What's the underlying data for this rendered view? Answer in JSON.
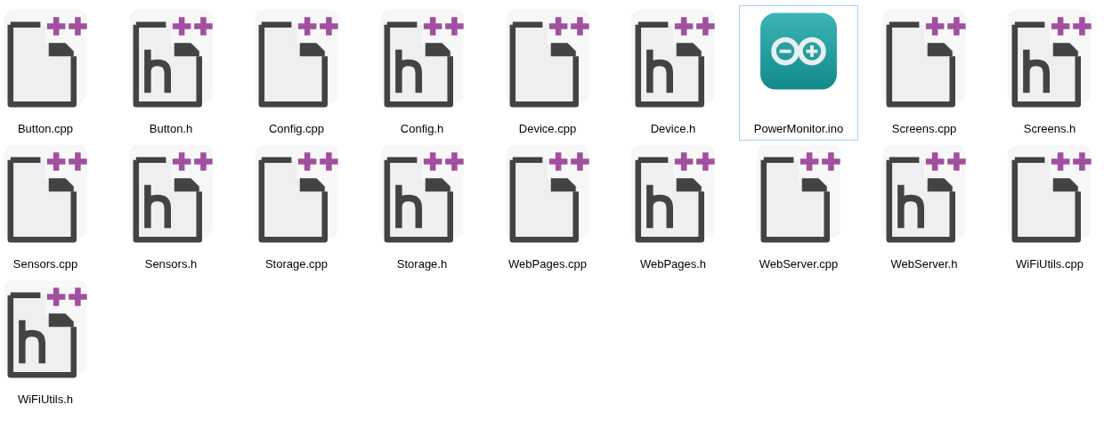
{
  "files": [
    {
      "name": "Button.cpp",
      "kind": "cpp",
      "selected": false
    },
    {
      "name": "Button.h",
      "kind": "h",
      "selected": false
    },
    {
      "name": "Config.cpp",
      "kind": "cpp",
      "selected": false
    },
    {
      "name": "Config.h",
      "kind": "h",
      "selected": false
    },
    {
      "name": "Device.cpp",
      "kind": "cpp",
      "selected": false
    },
    {
      "name": "Device.h",
      "kind": "h",
      "selected": false
    },
    {
      "name": "PowerMonitor.ino",
      "kind": "ino",
      "selected": true
    },
    {
      "name": "Screens.cpp",
      "kind": "cpp",
      "selected": false
    },
    {
      "name": "Screens.h",
      "kind": "h",
      "selected": false
    },
    {
      "name": "Sensors.cpp",
      "kind": "cpp",
      "selected": false
    },
    {
      "name": "Sensors.h",
      "kind": "h",
      "selected": false
    },
    {
      "name": "Storage.cpp",
      "kind": "cpp",
      "selected": false
    },
    {
      "name": "Storage.h",
      "kind": "h",
      "selected": false
    },
    {
      "name": "WebPages.cpp",
      "kind": "cpp",
      "selected": false
    },
    {
      "name": "WebPages.h",
      "kind": "h",
      "selected": false
    },
    {
      "name": "WebServer.cpp",
      "kind": "cpp",
      "selected": false
    },
    {
      "name": "WebServer.h",
      "kind": "h",
      "selected": false
    },
    {
      "name": "WiFiUtils.cpp",
      "kind": "cpp",
      "selected": false
    },
    {
      "name": "WiFiUtils.h",
      "kind": "h",
      "selected": false
    }
  ]
}
